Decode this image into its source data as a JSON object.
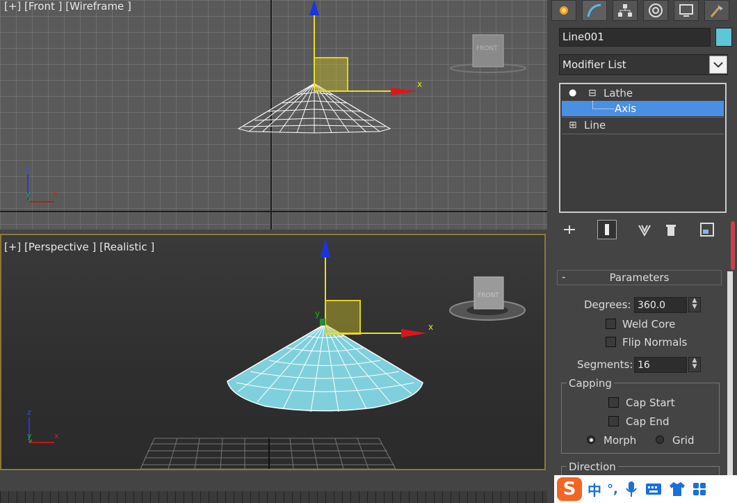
{
  "viewports": {
    "front": {
      "label": "[+] [Front ] [Wireframe ]",
      "axis_x": "x",
      "gizmo_z": "z",
      "gizmo_y": "y",
      "gizmo_x": "x",
      "viewcube": "FRONT"
    },
    "perspective": {
      "label": "[+] [Perspective ] [Realistic ]",
      "axis_x": "x",
      "axis_y": "y",
      "gizmo_z": "z",
      "gizmo_y": "y",
      "gizmo_x": "x",
      "viewcube": "FRONT"
    }
  },
  "panel": {
    "tabs": [
      "create-icon",
      "modify-icon",
      "hierarchy-icon",
      "motion-icon",
      "display-icon",
      "utilities-icon"
    ],
    "object_name": "Line001",
    "object_color": "#5ec6d6",
    "modifier_list": "Modifier List",
    "stack": [
      {
        "label": "Lathe",
        "expander": "⊟"
      },
      {
        "label": "Axis"
      },
      {
        "label": "Line",
        "expander": "⊞"
      }
    ],
    "parameters": {
      "title": "Parameters",
      "collapse": "-",
      "degrees_label": "Degrees:",
      "degrees_value": "360.0",
      "weld_core": "Weld Core",
      "flip_normals": "Flip Normals",
      "segments_label": "Segments:",
      "segments_value": "16",
      "capping_title": "Capping",
      "cap_start": "Cap Start",
      "cap_end": "Cap End",
      "morph": "Morph",
      "grid": "Grid",
      "direction_title": "Direction"
    }
  },
  "ime": {
    "logo": "S",
    "mode": "中",
    "punct": "°,"
  }
}
